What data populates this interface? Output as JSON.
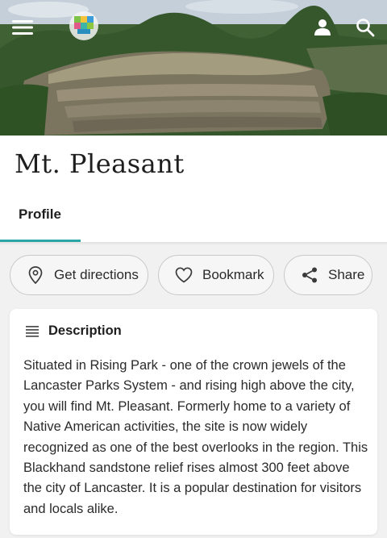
{
  "header": {
    "menu_icon": "hamburger-menu-icon",
    "logo": "city-logo",
    "user_icon": "user-icon",
    "search_icon": "search-icon"
  },
  "page": {
    "title": "Mt. Pleasant"
  },
  "tabs": [
    {
      "label": "Profile",
      "active": true
    }
  ],
  "actions": {
    "directions_label": "Get directions",
    "bookmark_label": "Bookmark",
    "share_label": "Share"
  },
  "description": {
    "heading": "Description",
    "text": "Situated in Rising Park - one of the crown jewels of the Lancaster Parks System - and rising high above the city, you will find Mt. Pleasant.  Formerly home to a variety of Native American activities, the site is now widely recognized as one of the best overlooks in the region. This Blackhand sandstone relief rises almost 300 feet above the city of Lancaster.  It is a popular destination for visitors and locals alike."
  },
  "colors": {
    "accent": "#2aa6a6",
    "card_bg": "#ffffff",
    "page_bg": "#f1f1f1",
    "pill_border": "#c9c9c9"
  }
}
